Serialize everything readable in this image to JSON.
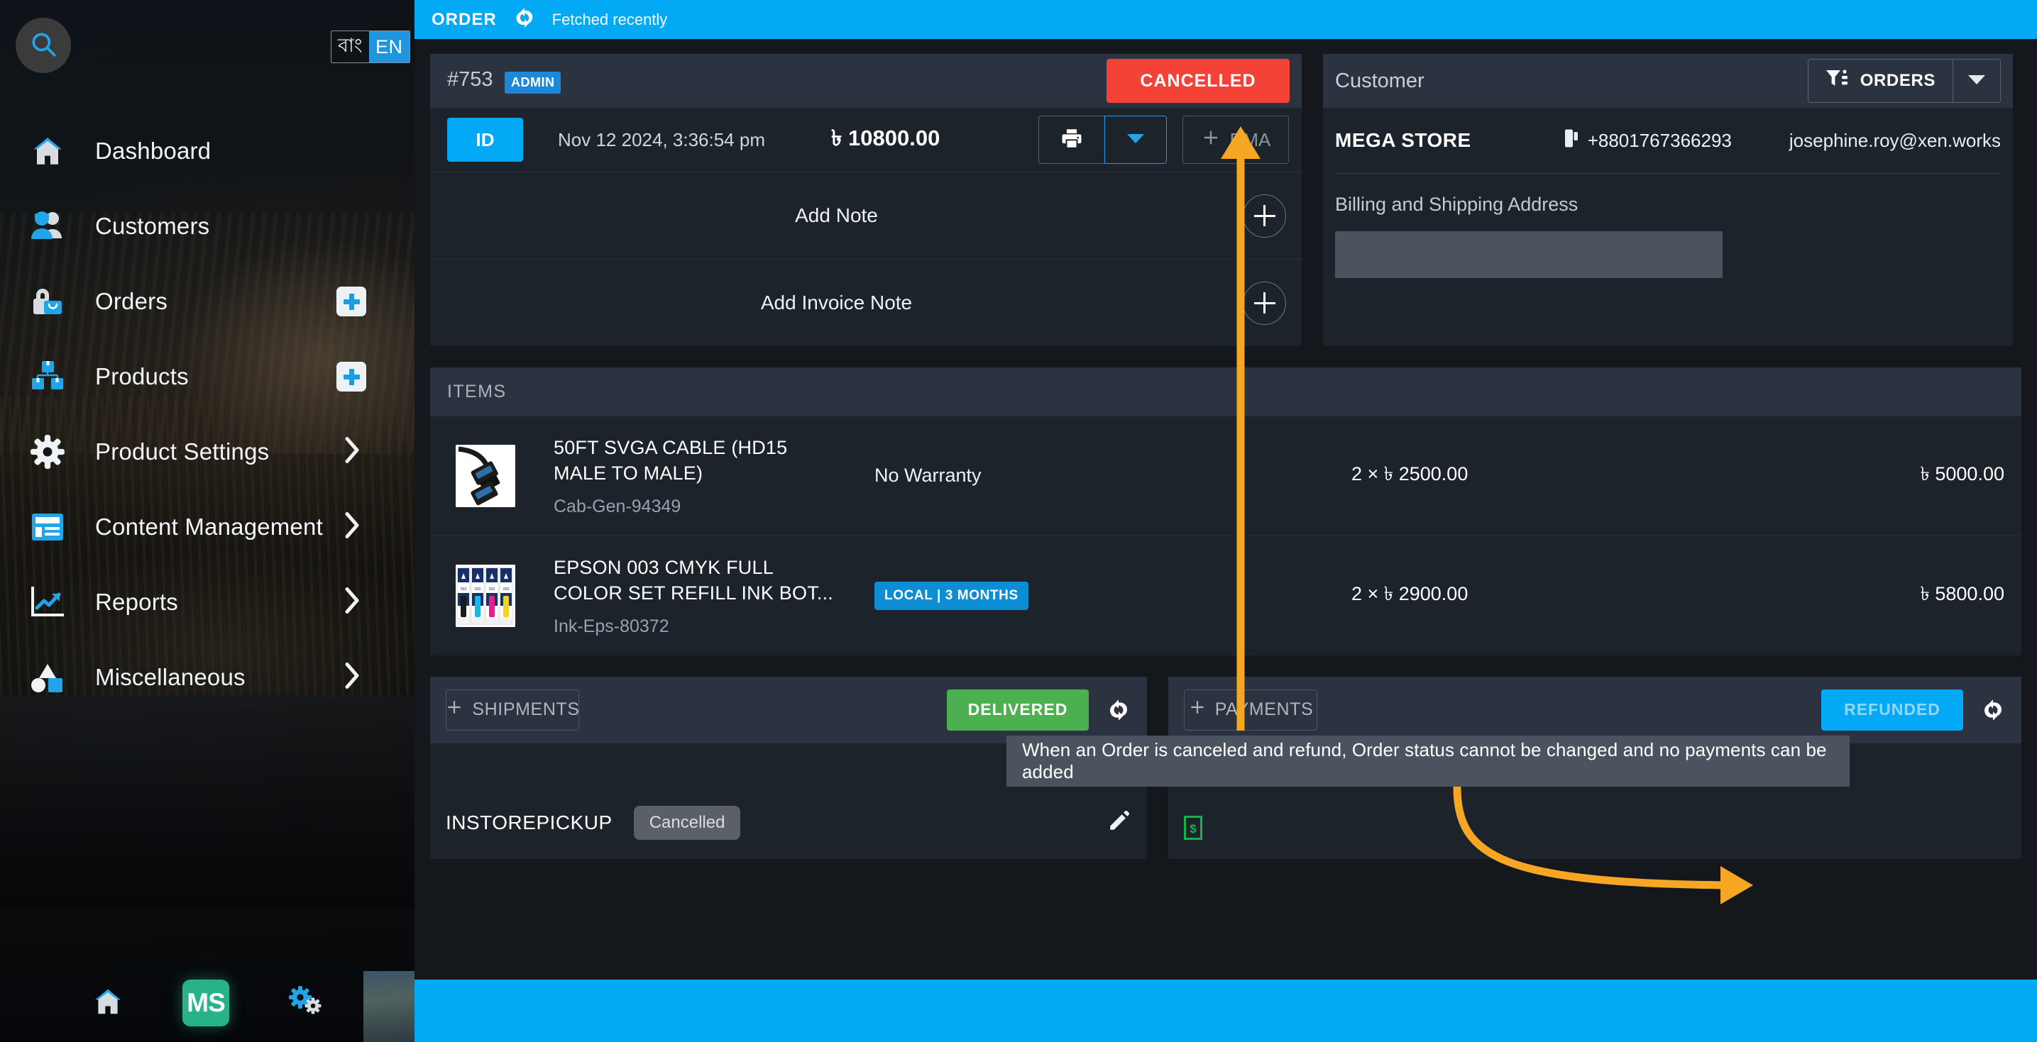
{
  "sidebar": {
    "search_icon": "search-icon",
    "language": {
      "other": "বাং",
      "active": "EN"
    },
    "items": [
      {
        "label": "Dashboard",
        "icon": "home-icon",
        "badge": null,
        "chevron": false
      },
      {
        "label": "Customers",
        "icon": "users-icon",
        "badge": null,
        "chevron": false
      },
      {
        "label": "Orders",
        "icon": "bag-lock-icon",
        "badge": "plus",
        "chevron": false
      },
      {
        "label": "Products",
        "icon": "boxes-icon",
        "badge": "plus",
        "chevron": false
      },
      {
        "label": "Product Settings",
        "icon": "gear-icon",
        "badge": null,
        "chevron": true
      },
      {
        "label": "Content Management",
        "icon": "article-icon",
        "badge": null,
        "chevron": true
      },
      {
        "label": "Reports",
        "icon": "chart-icon",
        "badge": null,
        "chevron": true
      },
      {
        "label": "Miscellaneous",
        "icon": "shapes-icon",
        "badge": null,
        "chevron": true
      }
    ],
    "taskbar": {
      "home_icon": "home-icon",
      "app_tile": "MS",
      "settings_icon": "gears-icon"
    }
  },
  "topbar": {
    "title": "ORDER",
    "refresh_icon": "refresh-icon",
    "status": "Fetched recently"
  },
  "order": {
    "number": "#753",
    "role_badge": "ADMIN",
    "status_button": "CANCELLED",
    "status_color": "#f44336",
    "id_chip": "ID",
    "date": "Nov 12 2024, 3:36:54 pm",
    "total": "৳ 10800.00",
    "print_icon": "printer-icon",
    "print_caret_icon": "chevron-down-icon",
    "rma_button": "RMA",
    "notes": [
      {
        "label": "Add Note",
        "action_icon": "plus-icon"
      },
      {
        "label": "Add Invoice Note",
        "action_icon": "plus-icon"
      }
    ]
  },
  "customer": {
    "heading": "Customer",
    "orders_button": "ORDERS",
    "filter_icon": "filter-icon",
    "caret_icon": "chevron-down-icon",
    "name": "MEGA STORE",
    "phone_icon": "phone-icon",
    "phone": "+8801767366293",
    "email": "josephine.roy@xen.works",
    "address_label": "Billing and Shipping Address",
    "address_value": ""
  },
  "items": {
    "heading": "ITEMS",
    "rows": [
      {
        "thumb": "svga-cable-thumbnail",
        "name": "50FT SVGA CABLE (HD15 MALE TO MALE)",
        "sku": "Cab-Gen-94349",
        "warranty_text": "No Warranty",
        "warranty_chip": null,
        "unit": "2 × ৳ 2500.00",
        "total": "৳ 5000.00"
      },
      {
        "thumb": "epson-ink-bottles-thumbnail",
        "name": "EPSON 003 CMYK FULL COLOR SET REFILL INK BOT...",
        "sku": "Ink-Eps-80372",
        "warranty_text": null,
        "warranty_chip": "LOCAL | 3 MONTHS",
        "unit": "2 × ৳ 2900.00",
        "total": "৳ 5800.00"
      }
    ]
  },
  "shipments": {
    "add_button": "SHIPMENTS",
    "add_icon": "plus-icon",
    "status_button": "DELIVERED",
    "status_color": "#4caf50",
    "refresh_icon": "refresh-icon",
    "row": {
      "method": "INSTOREPICKUP",
      "state": "Cancelled",
      "edit_icon": "pencil-icon"
    }
  },
  "payments": {
    "add_button": "PAYMENTS",
    "add_icon": "plus-icon",
    "status_button": "REFUNDED",
    "status_color": "#03a9f4",
    "refresh_icon": "refresh-icon",
    "money_icon": "money-icon"
  },
  "annotation": {
    "tooltip": "When an Order is canceled and refund, Order status cannot be changed and no payments can be added",
    "arrow_color": "#f5a623"
  }
}
